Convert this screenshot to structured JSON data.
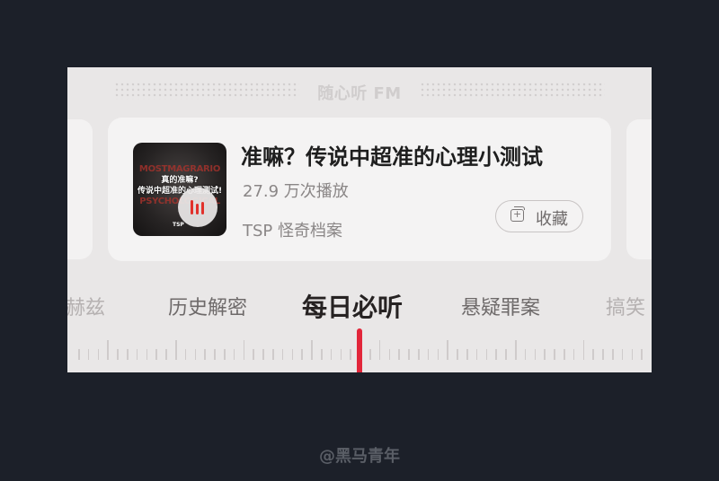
{
  "header": {
    "title": "随心听 FM"
  },
  "card": {
    "cover": {
      "bg_text_1": "MOSTMAGRARIO",
      "bg_text_2": "PSYCHOLOGICAL",
      "line1": "真的准嘛?",
      "line2": "传说中超准的心理测试!",
      "logo": "TSP"
    },
    "title": "准嘛？传说中超准的心理小测试",
    "plays": "27.9 万次播放",
    "author": "TSP 怪奇档案",
    "favorite_label": "收藏"
  },
  "channels": [
    {
      "label": "赫兹",
      "state": "faded"
    },
    {
      "label": "历史解密",
      "state": "normal"
    },
    {
      "label": "每日必听",
      "state": "active"
    },
    {
      "label": "悬疑罪案",
      "state": "normal"
    },
    {
      "label": "搞笑",
      "state": "faded"
    }
  ],
  "colors": {
    "accent": "#e2263a",
    "background": "#1c2029",
    "panel": "#e9e7e7"
  },
  "watermark": "@黑马青年"
}
